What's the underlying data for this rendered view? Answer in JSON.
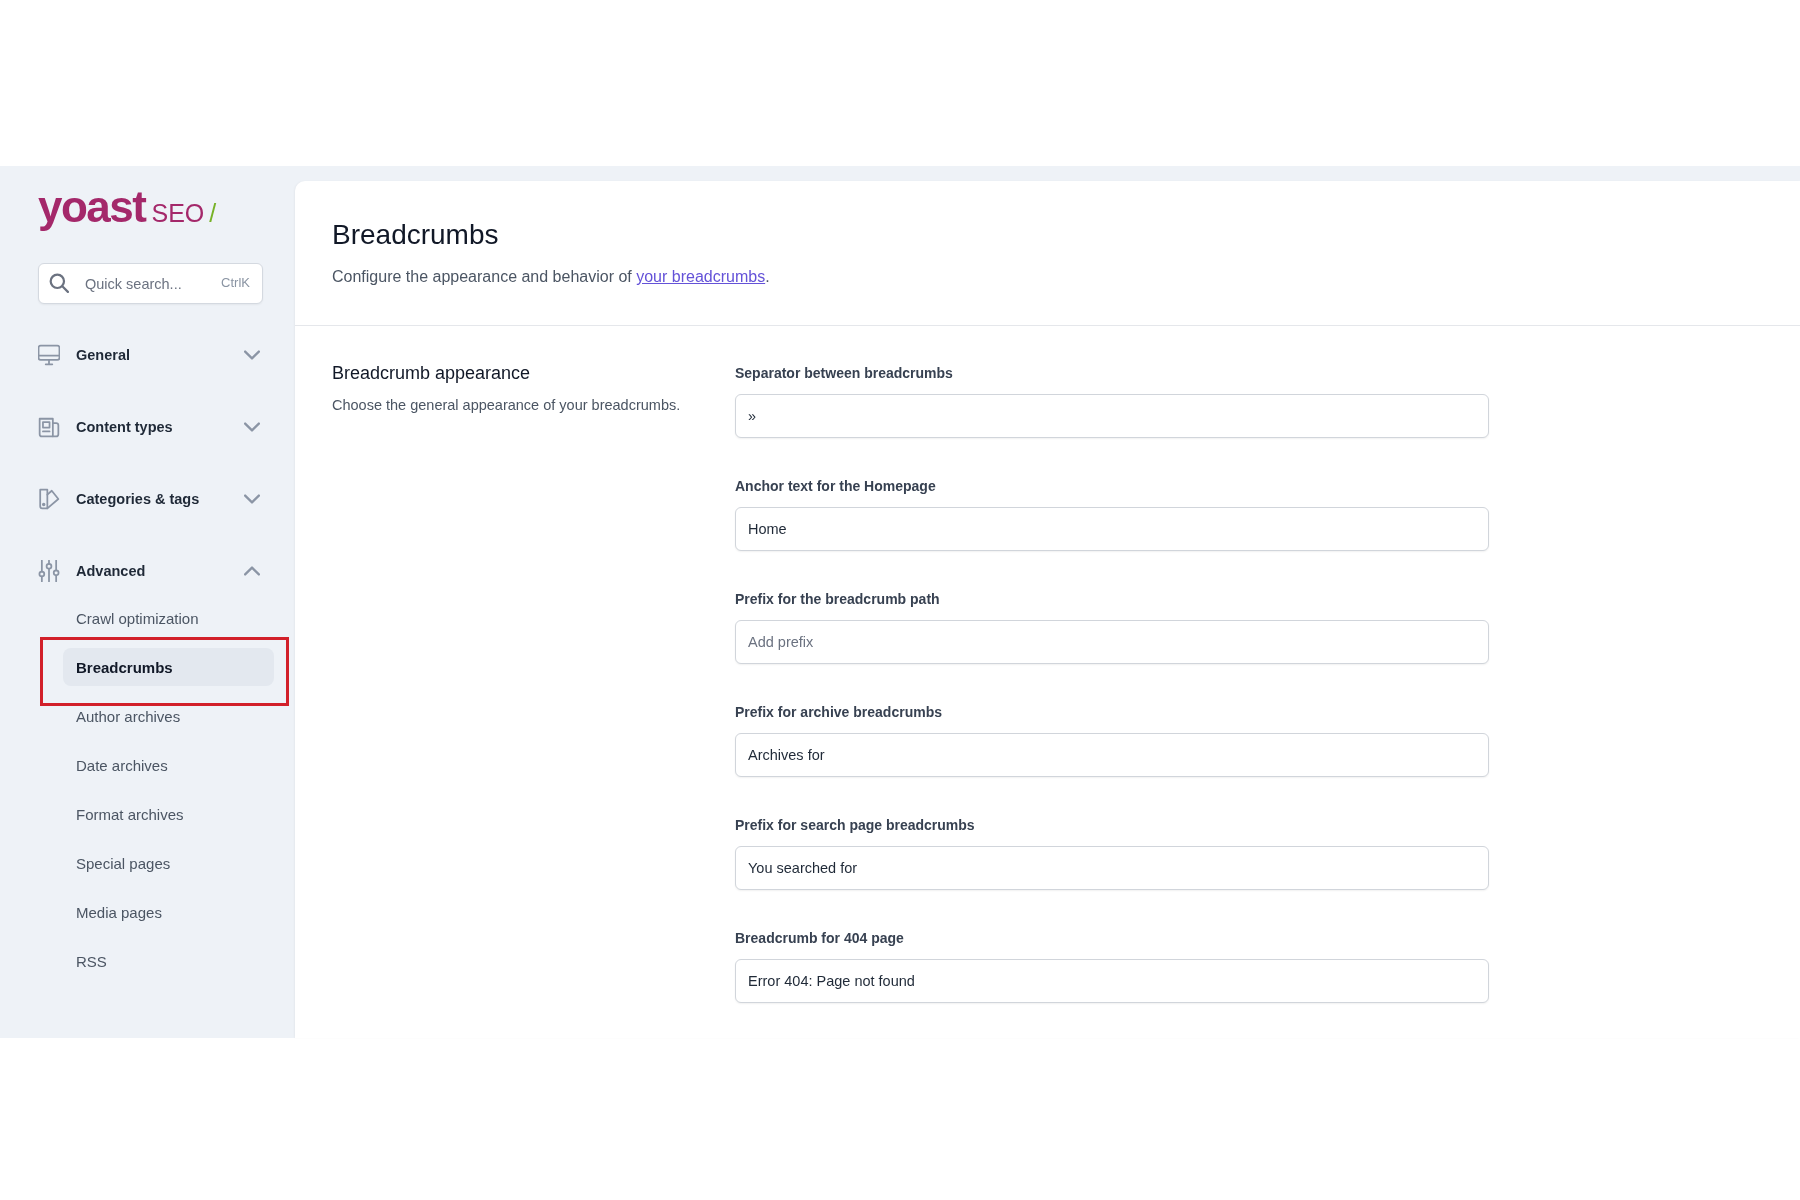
{
  "logo": {
    "wordmark": "yoast",
    "product": "SEO",
    "mark": "/"
  },
  "search": {
    "placeholder": "Quick search...",
    "shortcut": "CtrlK"
  },
  "sidebar": {
    "items": [
      {
        "label": "General",
        "expanded": false
      },
      {
        "label": "Content types",
        "expanded": false
      },
      {
        "label": "Categories & tags",
        "expanded": false
      },
      {
        "label": "Advanced",
        "expanded": true,
        "children": [
          {
            "label": "Crawl optimization",
            "selected": false,
            "highlighted": false
          },
          {
            "label": "Breadcrumbs",
            "selected": true,
            "highlighted": true
          },
          {
            "label": "Author archives",
            "selected": false,
            "highlighted": false
          },
          {
            "label": "Date archives",
            "selected": false,
            "highlighted": false
          },
          {
            "label": "Format archives",
            "selected": false,
            "highlighted": false
          },
          {
            "label": "Special pages",
            "selected": false,
            "highlighted": false
          },
          {
            "label": "Media pages",
            "selected": false,
            "highlighted": false
          },
          {
            "label": "RSS",
            "selected": false,
            "highlighted": false
          }
        ]
      }
    ]
  },
  "header": {
    "title": "Breadcrumbs",
    "description_before": "Configure the appearance and behavior of ",
    "link": "your breadcrumbs",
    "description_after": "."
  },
  "section": {
    "title": "Breadcrumb appearance",
    "description": "Choose the general appearance of your breadcrumbs.",
    "fields": [
      {
        "label": "Separator between breadcrumbs",
        "value": "»"
      },
      {
        "label": "Anchor text for the Homepage",
        "value": "Home"
      },
      {
        "label": "Prefix for the breadcrumb path",
        "placeholder": "Add prefix"
      },
      {
        "label": "Prefix for archive breadcrumbs",
        "value": "Archives for"
      },
      {
        "label": "Prefix for search page breadcrumbs",
        "value": "You searched for"
      },
      {
        "label": "Breadcrumb for 404 page",
        "value": "Error 404: Page not found"
      }
    ]
  }
}
